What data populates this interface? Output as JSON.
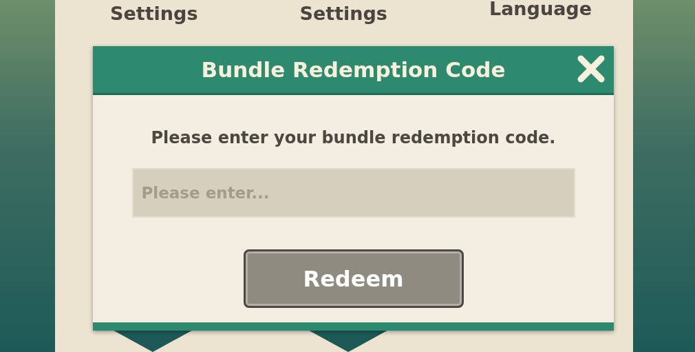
{
  "background_tabs": [
    {
      "label": "Settings"
    },
    {
      "label": "Settings"
    },
    {
      "label": "Language"
    }
  ],
  "dialog": {
    "title": "Bundle Redemption Code",
    "prompt": "Please enter your bundle redemption code.",
    "input": {
      "placeholder": "Please enter..."
    },
    "button": "Redeem"
  }
}
